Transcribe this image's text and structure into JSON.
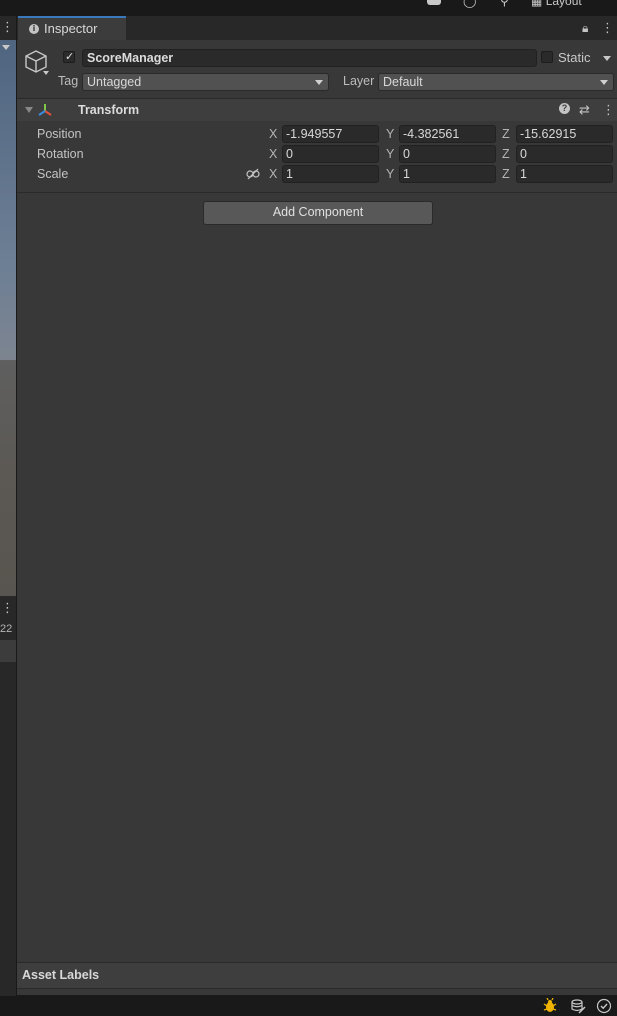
{
  "top_toolbar": {
    "layout_label": "Layout",
    "icons": [
      "account-icon",
      "cloud-icon",
      "search-icon",
      "layout-icon"
    ]
  },
  "left_panel": {
    "partial_number": "22"
  },
  "inspector": {
    "tab_label": "Inspector",
    "game_object": {
      "active": true,
      "name": "ScoreManager",
      "static_label": "Static",
      "static": false,
      "tag_label": "Tag",
      "tag_value": "Untagged",
      "layer_label": "Layer",
      "layer_value": "Default"
    },
    "transform": {
      "title": "Transform",
      "rows": [
        {
          "label": "Position",
          "x": "-1.949557",
          "y": "-4.382561",
          "z": "-15.62915"
        },
        {
          "label": "Rotation",
          "x": "0",
          "y": "0",
          "z": "0"
        },
        {
          "label": "Scale",
          "x": "1",
          "y": "1",
          "z": "1"
        }
      ],
      "axis_labels": {
        "x": "X",
        "y": "Y",
        "z": "Z"
      }
    },
    "add_component_label": "Add Component",
    "asset_labels_title": "Asset Labels"
  },
  "status_bar": {
    "icons": [
      "bug-icon",
      "cache-server-icon",
      "status-check-icon"
    ]
  },
  "colors": {
    "panel_bg": "#383838",
    "header_bg": "#3e3e3e",
    "field_bg": "#2a2a2a",
    "dropdown_bg": "#515151",
    "button_bg": "#585858",
    "tab_accent": "#3a79bb",
    "bug_icon": "#f0b400"
  }
}
